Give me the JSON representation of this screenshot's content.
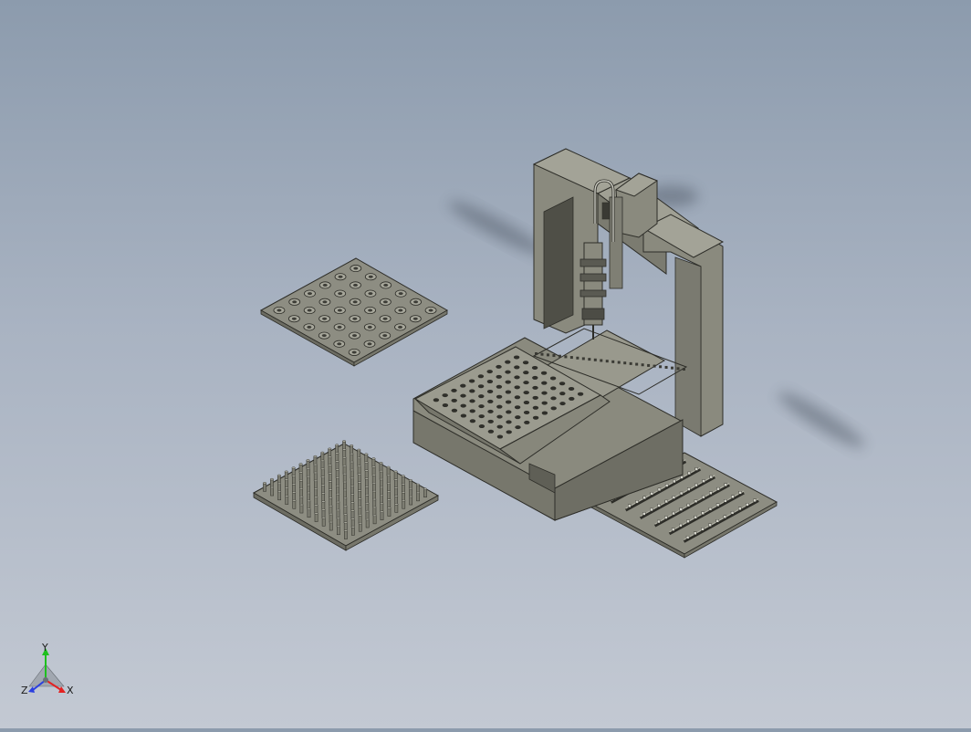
{
  "triad": {
    "y_label": "Y",
    "z_label": "Z",
    "x_label": "X",
    "colors": {
      "x": "#e32222",
      "y": "#1ec01e",
      "z": "#2a3fe0"
    }
  },
  "colors": {
    "metal": "#8a8a7e",
    "metal_dark": "#6c6c62",
    "metal_light": "#a3a397",
    "edge": "#2d2d28"
  },
  "grids": {
    "round_plate_rows": 6,
    "round_plate_cols": 6,
    "pin_plate_rows": 12,
    "pin_plate_cols": 12,
    "rail_plate_rows": 6,
    "rail_plate_cols": 10,
    "tray_rows": 8,
    "tray_cols": 10
  }
}
